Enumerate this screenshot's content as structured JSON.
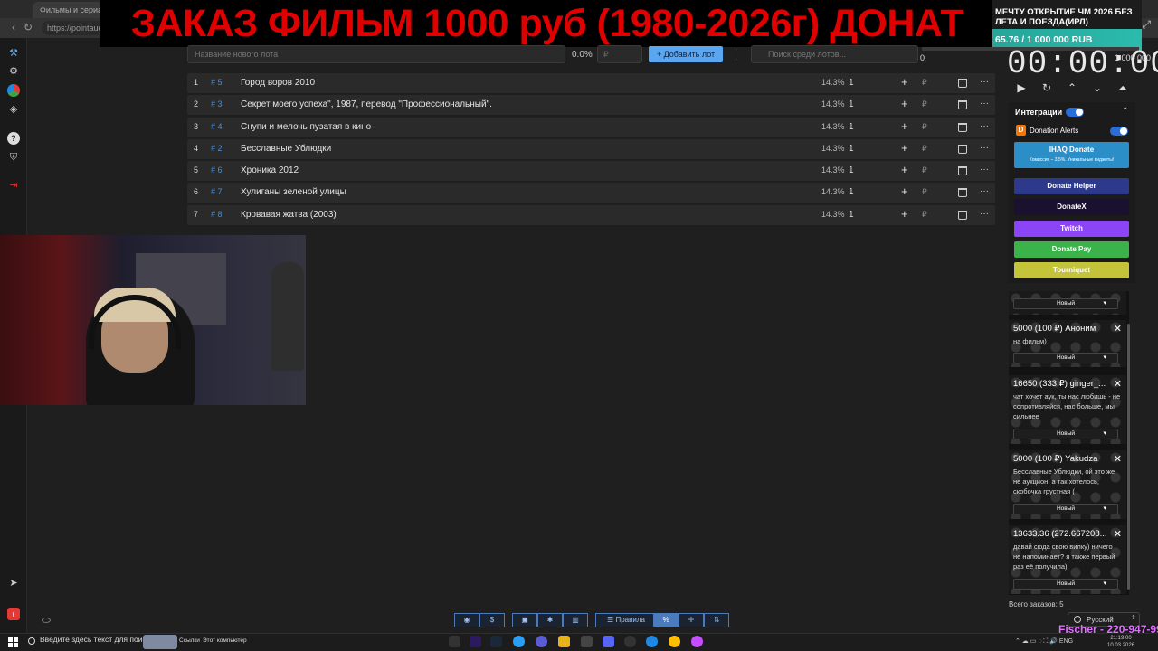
{
  "browser": {
    "tab_title": "Фильмы и сериалы - Kino",
    "url": "https://pointauc.co",
    "window_controls": "⤢"
  },
  "overlay": {
    "title": "ЗАКАЗ ФИЛЬМ 1000 руб (1980-2026г) ДОНАТ"
  },
  "sidebar": {
    "icons": [
      "hammer-icon",
      "gear-icon",
      "chart-icon",
      "layers-icon",
      "help-icon",
      "shield-icon",
      "logout-icon",
      "telegram-icon",
      "brand-icon"
    ]
  },
  "controls": {
    "lot_placeholder": "Название нового лота",
    "percent": "0.0%",
    "price_placeholder": "₽",
    "add_lot_label": "Добавить лот",
    "search_placeholder": "Поиск среди лотов..."
  },
  "lots": [
    {
      "num": "1",
      "id": "# 5",
      "name": "Город воров 2010",
      "pct": "14.3%",
      "amount": "1"
    },
    {
      "num": "2",
      "id": "# 3",
      "name": "Секрет моего успеха\", 1987, перевод \"Профессиональный\".",
      "pct": "14.3%",
      "amount": "1"
    },
    {
      "num": "3",
      "id": "# 4",
      "name": "Снупи и мелочь пузатая в кино",
      "pct": "14.3%",
      "amount": "1"
    },
    {
      "num": "4",
      "id": "# 2",
      "name": "Бесславные Ублюдки",
      "pct": "14.3%",
      "amount": "1"
    },
    {
      "num": "5",
      "id": "# 6",
      "name": "Хроника 2012",
      "pct": "14.3%",
      "amount": "1"
    },
    {
      "num": "6",
      "id": "# 7",
      "name": "Хулиганы зеленой улицы",
      "pct": "14.3%",
      "amount": "1"
    },
    {
      "num": "7",
      "id": "# 8",
      "name": "Кровавая жатва (2003)",
      "pct": "14.3%",
      "amount": "1"
    }
  ],
  "row_actions": {
    "plus": "+",
    "rub": "₽",
    "more": "···"
  },
  "donation_goal": {
    "info": "МЕЧТУ ОТКРЫТИЕ ЧМ 2026 БЕЗ\nЛЕТА И ПОЕЗДА(ИРЛ)",
    "progress": "65.76 / 1 000 000 RUB"
  },
  "timer": {
    "display": "00:00:00",
    "min": "0",
    "max": "1 000 000"
  },
  "integrations": {
    "title": "Интеграции",
    "donation_alerts": "Donation Alerts",
    "ihaq_label": "IHAQ Donate",
    "ihaq_sub": "Комиссия – 3,5%. Уникальные виджеты!",
    "buttons": [
      {
        "label": "Donate Helper",
        "color": "#2d3a8c"
      },
      {
        "label": "DonateX",
        "color": "#1a1030"
      },
      {
        "label": "Twitch",
        "color": "#8c44f7"
      },
      {
        "label": "Donate Pay",
        "color": "#3bb24a"
      },
      {
        "label": "Tourniquet",
        "color": "#c4c43a"
      }
    ]
  },
  "feed": {
    "status_label": "Новый",
    "items": [
      {
        "head": "5000 (100 ₽) Аноним",
        "msg": "на фильм)"
      },
      {
        "head": "16650 (333 ₽) ginger_...",
        "msg": "чат хочет аук, ты нас любишь - не сопротивляйся, нас больше, мы сильнее"
      },
      {
        "head": "5000 (100 ₽) Yakudza",
        "msg": "Бесславные Ублюдки, ой это же не аукцион, а так хотелось, скобочка грустная ("
      },
      {
        "head": "13633.36 (272.667208...",
        "msg": "давай сюда свою вилку) ничего не напоминает? я также первый раз её получила)"
      }
    ],
    "total_label": "Всего заказов:",
    "total_value": "5",
    "language": "Русский"
  },
  "toolbar": {
    "rules_label": "Правила",
    "percent_label": "%"
  },
  "taskbar": {
    "search_placeholder": "Введите здесь текст для поиска",
    "links_label": "Ссылки",
    "pc_label": "Этот компьютер",
    "tray": "⌃  ☁  ▭  ◌  ⛶  🔊  ENG",
    "time": "21:19:00",
    "date": "10.03.2026"
  },
  "stream_overlay": {
    "fischer": "Fischer - 220-947-99"
  }
}
